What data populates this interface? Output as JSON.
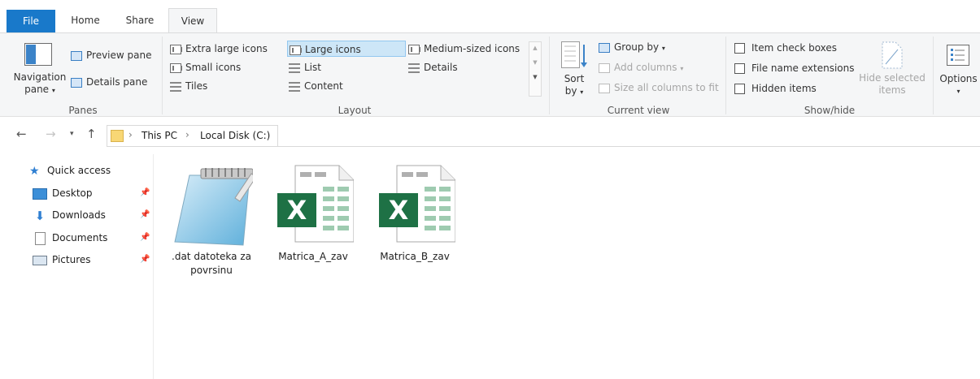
{
  "tabs": {
    "file": "File",
    "home": "Home",
    "share": "Share",
    "view": "View"
  },
  "ribbon": {
    "panes": {
      "navigation_pane": "Navigation",
      "navigation_pane_2": "pane",
      "preview_pane": "Preview pane",
      "details_pane": "Details pane",
      "label": "Panes"
    },
    "layout": {
      "extra_large": "Extra large icons",
      "large": "Large icons",
      "medium": "Medium-sized icons",
      "small": "Small icons",
      "list": "List",
      "details": "Details",
      "tiles": "Tiles",
      "content": "Content",
      "label": "Layout",
      "selected": "Large icons"
    },
    "current_view": {
      "sort_by": "Sort",
      "sort_by_2": "by",
      "group_by": "Group by",
      "add_columns": "Add columns",
      "size_all": "Size all columns to fit",
      "label": "Current view"
    },
    "show_hide": {
      "item_check_boxes": "Item check boxes",
      "file_name_extensions": "File name extensions",
      "hidden_items": "Hidden items",
      "hide_selected": "Hide selected",
      "hide_selected_2": "items",
      "label": "Show/hide"
    },
    "options": "Options"
  },
  "address": {
    "crumbs": [
      "This PC",
      "Local Disk (C:)"
    ]
  },
  "nav": {
    "quick_access": "Quick access",
    "items": [
      {
        "label": "Desktop",
        "pinned": true
      },
      {
        "label": "Downloads",
        "pinned": true
      },
      {
        "label": "Documents",
        "pinned": true
      },
      {
        "label": "Pictures",
        "pinned": true
      }
    ]
  },
  "files": [
    {
      "name_line1": ".dat datoteka za",
      "name_line2": "povrsinu",
      "icon": "notepad-icon"
    },
    {
      "name_line1": "Matrica_A_zav",
      "name_line2": "",
      "icon": "excel-icon"
    },
    {
      "name_line1": "Matrica_B_zav",
      "name_line2": "",
      "icon": "excel-icon"
    }
  ],
  "colors": {
    "file_tab": "#1979ca",
    "selection": "#cde6f7",
    "excel_green": "#1e7145"
  }
}
